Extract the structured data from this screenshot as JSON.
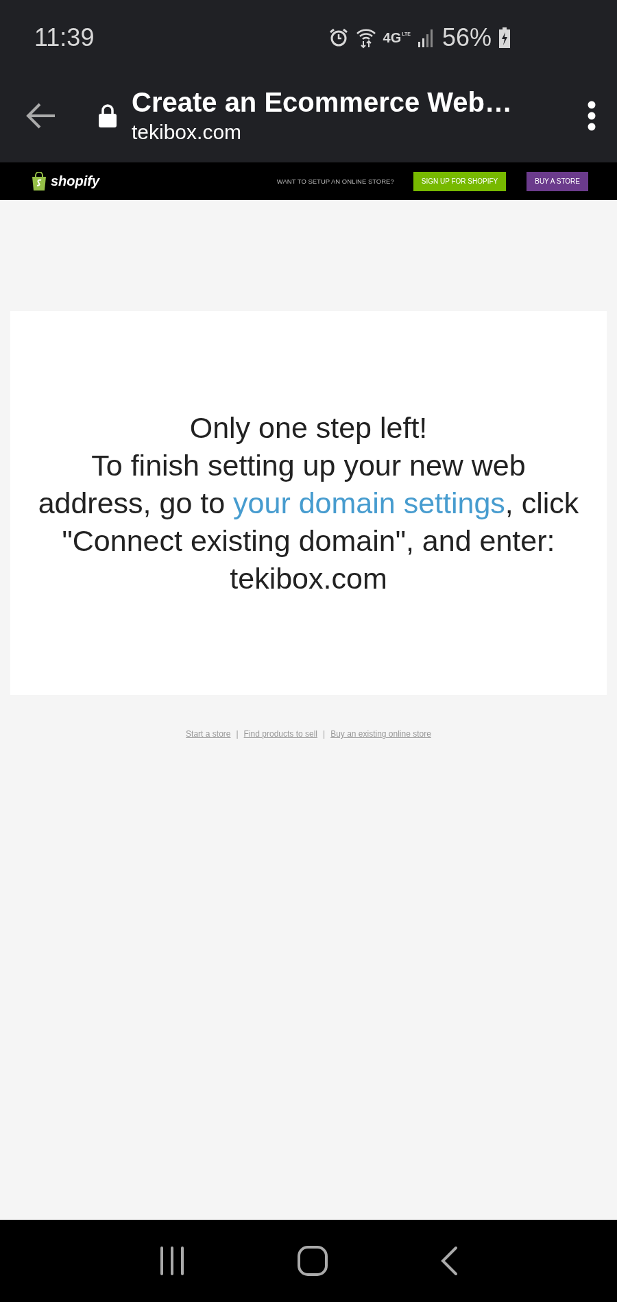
{
  "status_bar": {
    "time": "11:39",
    "network_type": "4G",
    "network_sub": "LTE",
    "battery": "56%"
  },
  "browser": {
    "title": "Create an Ecommerce Web…",
    "url": "tekibox.com"
  },
  "shopify_bar": {
    "logo": "shopify",
    "prompt": "WANT TO SETUP AN ONLINE STORE?",
    "buttons": [
      {
        "label": "SIGN UP FOR SHOPIFY",
        "kind": "signup"
      },
      {
        "label": "BUY A STORE",
        "kind": "buy"
      }
    ]
  },
  "card": {
    "heading": "Only one step left!",
    "before_link": "To finish setting up your new web address, go to ",
    "link": "your domain settings",
    "after_link": ", click \"Connect existing domain\", and enter: tekibox.com"
  },
  "footer_links": [
    "Start a store",
    "Find products to sell",
    "Buy an existing online store"
  ],
  "separator": "|"
}
